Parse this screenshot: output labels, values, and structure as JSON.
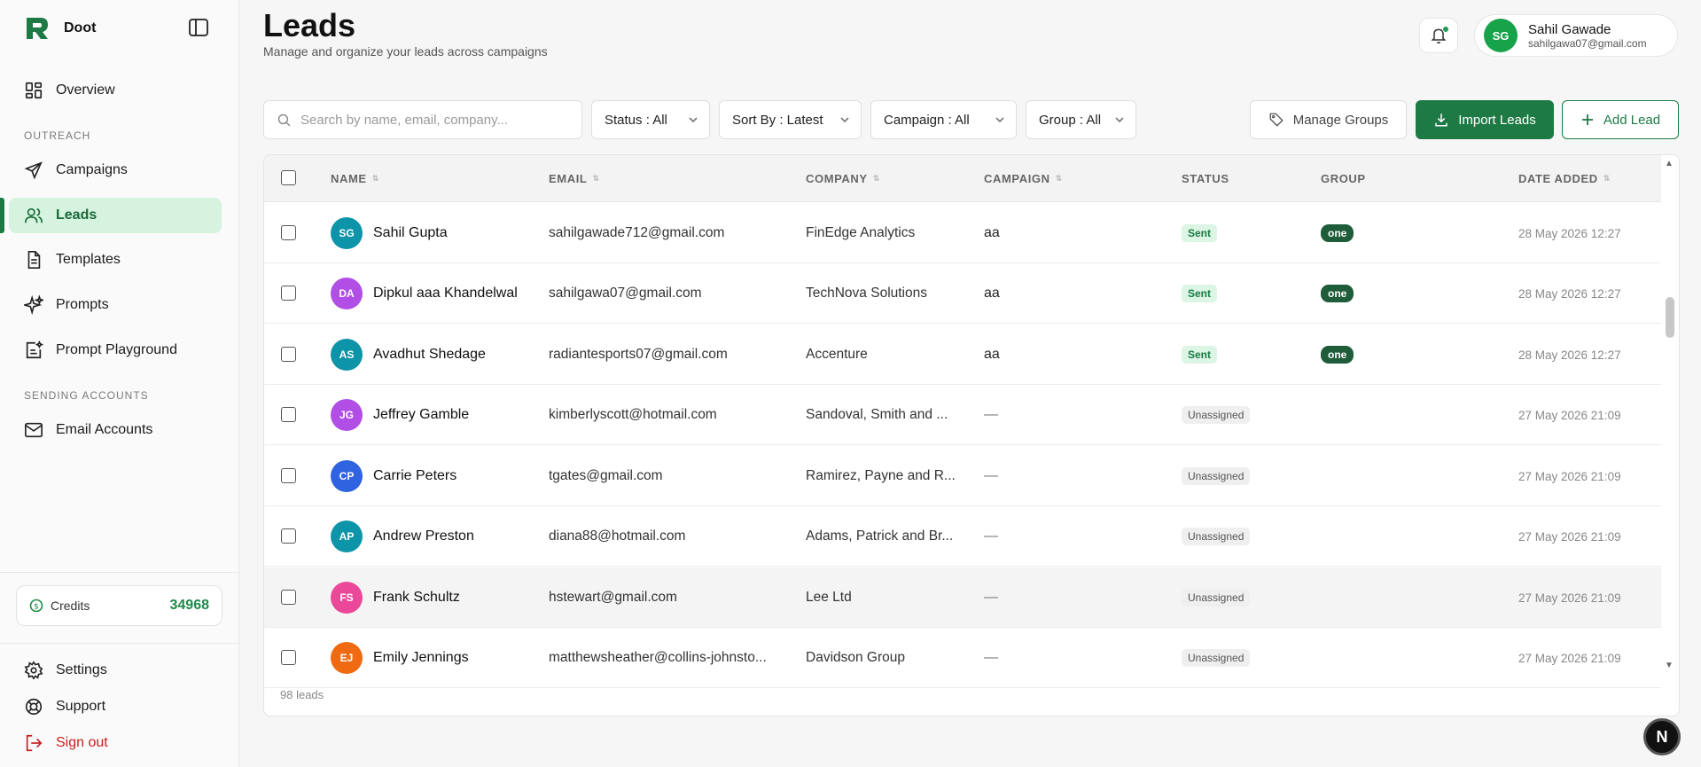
{
  "brand": {
    "name": "Doot"
  },
  "sidebar": {
    "overview": "Overview",
    "section_outreach": "OUTREACH",
    "items": [
      {
        "label": "Campaigns"
      },
      {
        "label": "Leads"
      },
      {
        "label": "Templates"
      },
      {
        "label": "Prompts"
      },
      {
        "label": "Prompt Playground"
      }
    ],
    "section_sending": "SENDING ACCOUNTS",
    "email_accounts": "Email Accounts",
    "credits_label": "Credits",
    "credits_value": "34968",
    "settings": "Settings",
    "support": "Support",
    "sign_out": "Sign out"
  },
  "header": {
    "title": "Leads",
    "subtitle": "Manage and organize your leads across campaigns",
    "user_initials": "SG",
    "user_name": "Sahil Gawade",
    "user_email": "sahilgawa07@gmail.com"
  },
  "toolbar": {
    "search_placeholder": "Search by name, email, company...",
    "status_filter": "Status : All",
    "sort_by": "Sort By : Latest",
    "campaign_filter": "Campaign : All",
    "group_filter": "Group : All",
    "manage_groups": "Manage Groups",
    "import_leads": "Import Leads",
    "add_lead": "Add Lead"
  },
  "table": {
    "columns": [
      "NAME",
      "EMAIL",
      "COMPANY",
      "CAMPAIGN",
      "STATUS",
      "GROUP",
      "DATE ADDED"
    ],
    "rows": [
      {
        "initials": "SG",
        "avatar_color": "#0e94a8",
        "name": "Sahil Gupta",
        "email": "sahilgawade712@gmail.com",
        "company": "FinEdge Analytics",
        "campaign": "aa",
        "status": "Sent",
        "group": "one",
        "date": "28 May 2026 12:27"
      },
      {
        "initials": "DA",
        "avatar_color": "#b04ee6",
        "name": "Dipkul aaa Khandelwal",
        "email": "sahilgawa07@gmail.com",
        "company": "TechNova Solutions",
        "campaign": "aa",
        "status": "Sent",
        "group": "one",
        "date": "28 May 2026 12:27"
      },
      {
        "initials": "AS",
        "avatar_color": "#0e94a8",
        "name": "Avadhut Shedage",
        "email": "radiantesports07@gmail.com",
        "company": "Accenture",
        "campaign": "aa",
        "status": "Sent",
        "group": "one",
        "date": "28 May 2026 12:27"
      },
      {
        "initials": "JG",
        "avatar_color": "#b04ee6",
        "name": "Jeffrey Gamble",
        "email": "kimberlyscott@hotmail.com",
        "company": "Sandoval, Smith and ...",
        "campaign": "—",
        "status": "Unassigned",
        "group": "",
        "date": "27 May 2026 21:09"
      },
      {
        "initials": "CP",
        "avatar_color": "#2f63e0",
        "name": "Carrie Peters",
        "email": "tgates@gmail.com",
        "company": "Ramirez, Payne and R...",
        "campaign": "—",
        "status": "Unassigned",
        "group": "",
        "date": "27 May 2026 21:09"
      },
      {
        "initials": "AP",
        "avatar_color": "#0e94a8",
        "name": "Andrew Preston",
        "email": "diana88@hotmail.com",
        "company": "Adams, Patrick and Br...",
        "campaign": "—",
        "status": "Unassigned",
        "group": "",
        "date": "27 May 2026 21:09"
      },
      {
        "initials": "FS",
        "avatar_color": "#ec4899",
        "name": "Frank Schultz",
        "email": "hstewart@gmail.com",
        "company": "Lee Ltd",
        "campaign": "—",
        "status": "Unassigned",
        "group": "",
        "date": "27 May 2026 21:09"
      },
      {
        "initials": "EJ",
        "avatar_color": "#f06a12",
        "name": "Emily Jennings",
        "email": "matthewsheather@collins-johnsto...",
        "company": "Davidson Group",
        "campaign": "—",
        "status": "Unassigned",
        "group": "",
        "date": "27 May 2026 21:09"
      }
    ],
    "footer_count": "98 leads"
  },
  "overlay_badge": "N",
  "colors": {
    "accent": "#1e7a45",
    "active_nav_bg": "#d6f3df",
    "sign_out": "#c81e1e"
  }
}
